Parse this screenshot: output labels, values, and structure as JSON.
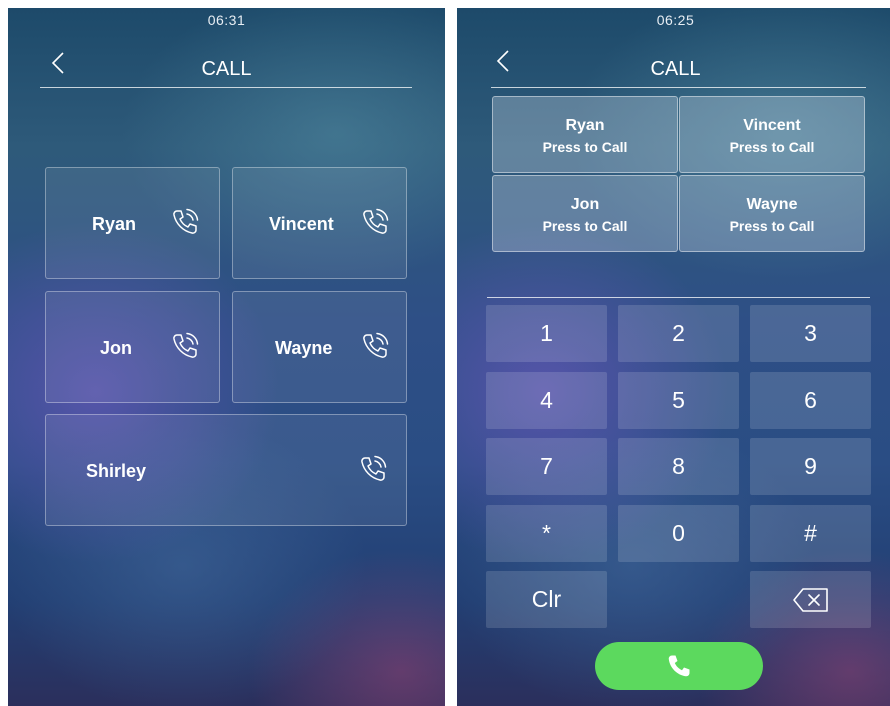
{
  "left_screen": {
    "status_time": "06:31",
    "title": "CALL",
    "contacts": [
      {
        "name": "Ryan"
      },
      {
        "name": "Vincent"
      },
      {
        "name": "Jon"
      },
      {
        "name": "Wayne"
      },
      {
        "name": "Shirley"
      }
    ]
  },
  "right_screen": {
    "status_time": "06:25",
    "title": "CALL",
    "quick_contacts": [
      {
        "name": "Ryan",
        "action": "Press to Call"
      },
      {
        "name": "Vincent",
        "action": "Press to Call"
      },
      {
        "name": "Jon",
        "action": "Press to Call"
      },
      {
        "name": "Wayne",
        "action": "Press to Call"
      }
    ],
    "dial_input_value": "",
    "keypad": [
      "1",
      "2",
      "3",
      "4",
      "5",
      "6",
      "7",
      "8",
      "9",
      "*",
      "0",
      "#"
    ],
    "clear_label": "Clr",
    "icons": {
      "back": "chevron-left-icon",
      "contact_call": "phone-ringing-icon",
      "backspace": "backspace-icon",
      "call": "phone-icon"
    },
    "colors": {
      "call_button": "#5cd95e"
    }
  }
}
